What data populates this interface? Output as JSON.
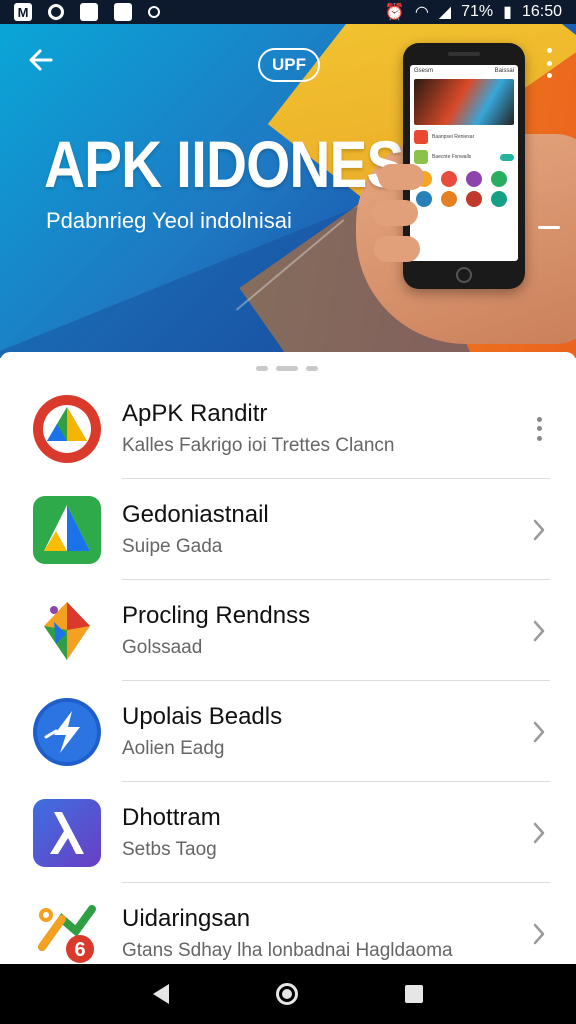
{
  "status_bar": {
    "left_icons": [
      "M",
      "",
      "",
      "",
      ""
    ],
    "battery": "71%",
    "time": "16:50"
  },
  "hero": {
    "logo_text": "UPF",
    "title": "APK IIDONESIA",
    "subtitle": "Pdabnrieg Yeol indolnisai"
  },
  "phone": {
    "top_left": "Gsesm",
    "top_right": "Baissai",
    "rows": [
      "Baanpsei Reniesar",
      "Baecnte Fsnwalls"
    ]
  },
  "list": {
    "items": [
      {
        "title": "ApPK Randitr",
        "subtitle": "Kalles Fakrigo ioi Trettes Clancn",
        "icon": "colorful-circle-app-icon",
        "trailing": "kebab"
      },
      {
        "title": "Gedoniastnail",
        "subtitle": "Suipe Gada",
        "icon": "green-triangle-app-icon",
        "trailing": "chevron"
      },
      {
        "title": "Procling Rendnss",
        "subtitle": "Golssaad",
        "icon": "colorful-kite-app-icon",
        "trailing": "chevron"
      },
      {
        "title": "Upolais Beadls",
        "subtitle": "Aolien Eadg",
        "icon": "blue-bolt-app-icon",
        "trailing": "chevron"
      },
      {
        "title": "Dhottram",
        "subtitle": "Setbs Taog",
        "icon": "purple-lambda-app-icon",
        "trailing": "chevron"
      },
      {
        "title": "Uidaringsan",
        "subtitle": "Gtans Sdhay lha lonbadnai Hagldaoma",
        "icon": "map-pin-app-icon",
        "trailing": "chevron"
      }
    ]
  },
  "colors": {
    "hero_blue": "#1e78c2",
    "hero_yellow": "#ffcf2a",
    "hero_orange": "#f28a1c",
    "divider": "#dcdcdc"
  }
}
